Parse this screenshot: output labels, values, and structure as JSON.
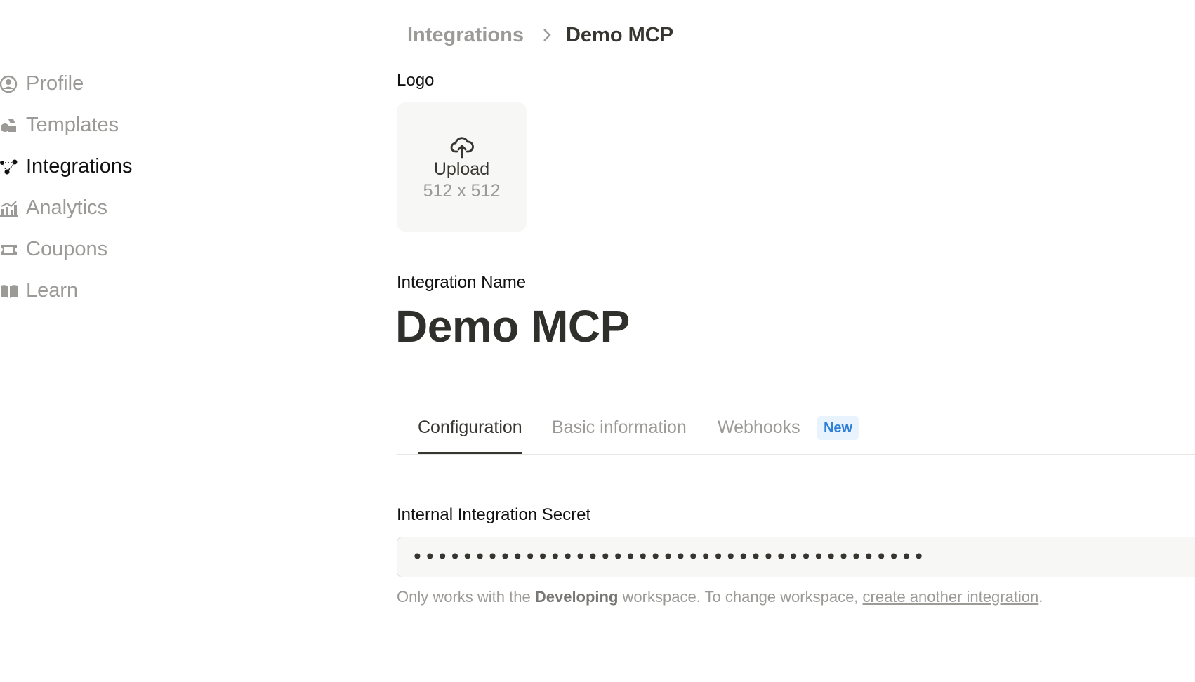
{
  "breadcrumb": {
    "parent": "Integrations",
    "current": "Demo MCP"
  },
  "sidebar": {
    "items": [
      {
        "label": "Profile",
        "icon": "profile-icon",
        "active": false
      },
      {
        "label": "Templates",
        "icon": "templates-icon",
        "active": false
      },
      {
        "label": "Integrations",
        "icon": "integrations-icon",
        "active": true
      },
      {
        "label": "Analytics",
        "icon": "analytics-icon",
        "active": false
      },
      {
        "label": "Coupons",
        "icon": "coupons-icon",
        "active": false
      },
      {
        "label": "Learn",
        "icon": "learn-icon",
        "active": false
      }
    ]
  },
  "logo": {
    "label": "Logo",
    "upload_label": "Upload",
    "size_hint": "512 x 512",
    "icon": "cloud-upload-icon"
  },
  "integration": {
    "name_label": "Integration Name",
    "name": "Demo MCP"
  },
  "tabs": [
    {
      "label": "Configuration",
      "active": true
    },
    {
      "label": "Basic information",
      "active": false
    },
    {
      "label": "Webhooks",
      "active": false,
      "badge": "New"
    }
  ],
  "secret": {
    "label": "Internal Integration Secret",
    "value": "•••••••••••••••••••••••••••••••••••••••••"
  },
  "helper": {
    "prefix": "Only works with the ",
    "workspace": "Developing",
    "middle": " workspace. To change workspace, ",
    "link": "create another integration",
    "suffix": "."
  },
  "colors": {
    "text_primary": "#37352f",
    "text_muted": "#9b9a97",
    "badge_bg": "#e9f3fe",
    "badge_text": "#2f7fd8",
    "field_bg": "#f7f7f5"
  }
}
